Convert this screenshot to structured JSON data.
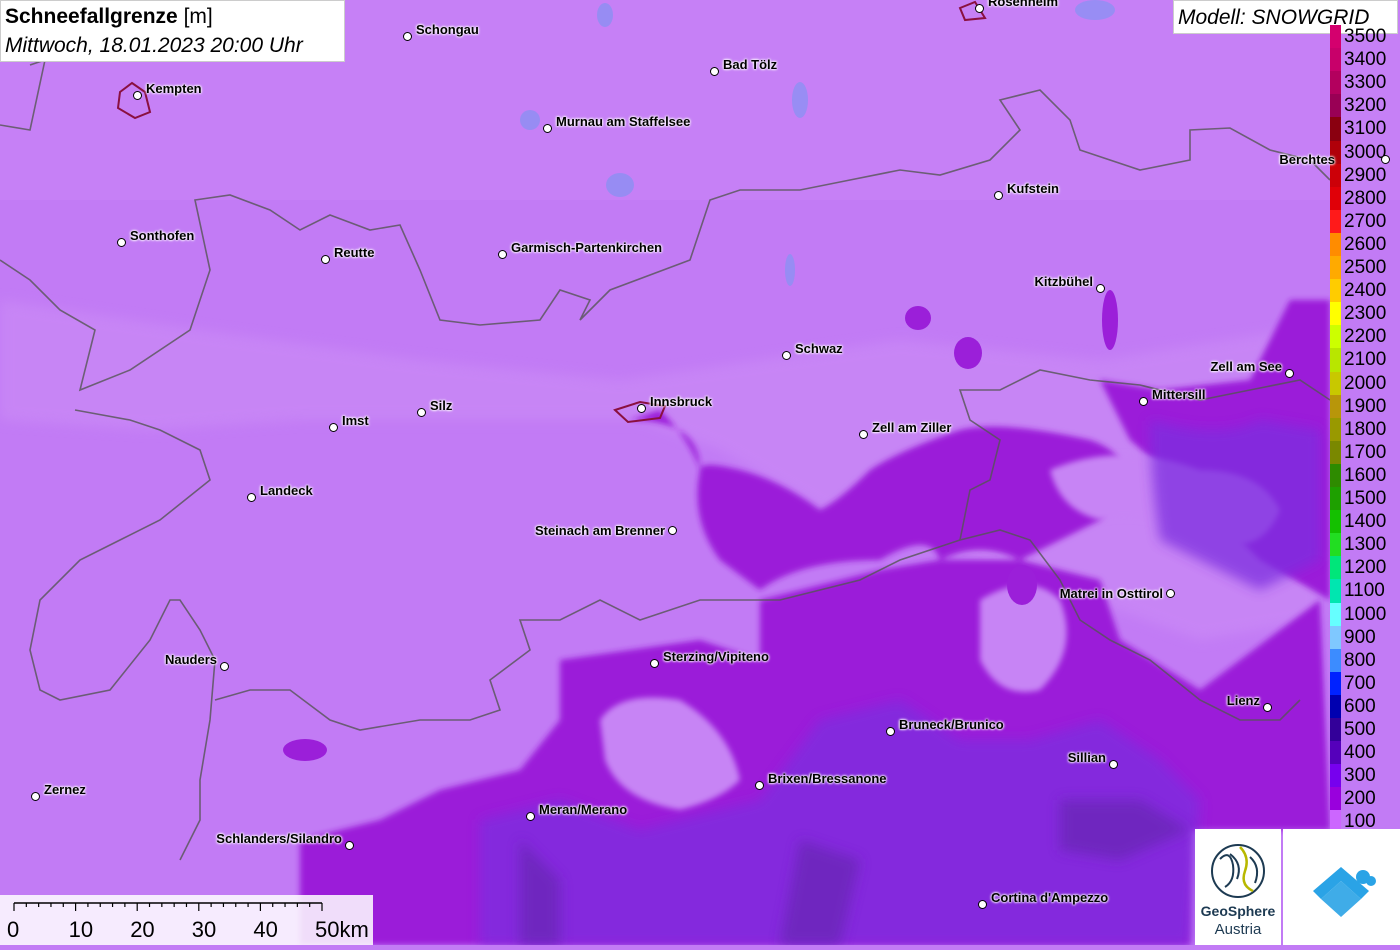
{
  "title": {
    "bold": "Schneefallgrenze",
    "unit": "[m]",
    "datetime": "Mittwoch, 18.01.2023 20:00 Uhr"
  },
  "model": "Modell: SNOWGRID",
  "legend": {
    "levels": [
      {
        "label": "3500",
        "color": "#d4006e"
      },
      {
        "label": "3400",
        "color": "#c8006a"
      },
      {
        "label": "3300",
        "color": "#b3005e"
      },
      {
        "label": "3200",
        "color": "#990055"
      },
      {
        "label": "3100",
        "color": "#8a0010"
      },
      {
        "label": "3000",
        "color": "#b0000a"
      },
      {
        "label": "2900",
        "color": "#cc0008"
      },
      {
        "label": "2800",
        "color": "#e00008"
      },
      {
        "label": "2700",
        "color": "#ff1a1a"
      },
      {
        "label": "2600",
        "color": "#ff8c00"
      },
      {
        "label": "2500",
        "color": "#ffaa00"
      },
      {
        "label": "2400",
        "color": "#ffcc00"
      },
      {
        "label": "2300",
        "color": "#ffff00"
      },
      {
        "label": "2200",
        "color": "#ccff00"
      },
      {
        "label": "2100",
        "color": "#b8e600"
      },
      {
        "label": "2000",
        "color": "#c8c800"
      },
      {
        "label": "1900",
        "color": "#b8960a"
      },
      {
        "label": "1800",
        "color": "#999900"
      },
      {
        "label": "1700",
        "color": "#7a8800"
      },
      {
        "label": "1600",
        "color": "#2e8b00"
      },
      {
        "label": "1500",
        "color": "#1ea000"
      },
      {
        "label": "1400",
        "color": "#14c000"
      },
      {
        "label": "1300",
        "color": "#22dd22"
      },
      {
        "label": "1200",
        "color": "#00e67a"
      },
      {
        "label": "1100",
        "color": "#00e6b0"
      },
      {
        "label": "1000",
        "color": "#66ffff"
      },
      {
        "label": "900",
        "color": "#7fc8ff"
      },
      {
        "label": "800",
        "color": "#3c8cff"
      },
      {
        "label": "700",
        "color": "#0022ff"
      },
      {
        "label": "600",
        "color": "#0000b0"
      },
      {
        "label": "500",
        "color": "#330099"
      },
      {
        "label": "400",
        "color": "#5500bb"
      },
      {
        "label": "300",
        "color": "#7700ee"
      },
      {
        "label": "200",
        "color": "#9900dd"
      },
      {
        "label": "100",
        "color": "#cc66ff"
      }
    ]
  },
  "cities": [
    {
      "name": "Rosenheim",
      "label_side": "right"
    },
    {
      "name": "Schongau",
      "label_side": "right"
    },
    {
      "name": "Bad Tölz",
      "label_side": "right"
    },
    {
      "name": "Kempten",
      "label_side": "right"
    },
    {
      "name": "Murnau am Staffelsee",
      "label_side": "right"
    },
    {
      "name": "Berchtes",
      "label_side": "left"
    },
    {
      "name": "Kufstein",
      "label_side": "right"
    },
    {
      "name": "Sonthofen",
      "label_side": "right"
    },
    {
      "name": "Reutte",
      "label_side": "right"
    },
    {
      "name": "Garmisch-Partenkirchen",
      "label_side": "right"
    },
    {
      "name": "Kitzbühel",
      "label_side": "left"
    },
    {
      "name": "Schwaz",
      "label_side": "right"
    },
    {
      "name": "Zell am See",
      "label_side": "left"
    },
    {
      "name": "Mittersill",
      "label_side": "right"
    },
    {
      "name": "Innsbruck",
      "label_side": "right"
    },
    {
      "name": "Silz",
      "label_side": "right"
    },
    {
      "name": "Imst",
      "label_side": "right"
    },
    {
      "name": "Zell am Ziller",
      "label_side": "right"
    },
    {
      "name": "Landeck",
      "label_side": "right"
    },
    {
      "name": "Steinach am Brenner",
      "label_side": "left"
    },
    {
      "name": "Matrei in Osttirol",
      "label_side": "left"
    },
    {
      "name": "Nauders",
      "label_side": "left"
    },
    {
      "name": "Sterzing/Vipiteno",
      "label_side": "right"
    },
    {
      "name": "Lienz",
      "label_side": "left"
    },
    {
      "name": "Bruneck/Brunico",
      "label_side": "right"
    },
    {
      "name": "Sillian",
      "label_side": "left"
    },
    {
      "name": "Brixen/Bressanone",
      "label_side": "right"
    },
    {
      "name": "Zernez",
      "label_side": "right"
    },
    {
      "name": "Meran/Merano",
      "label_side": "right"
    },
    {
      "name": "Schlanders/Silandro",
      "label_side": "left"
    },
    {
      "name": "Cortina d'Ampezzo",
      "label_side": "right"
    }
  ],
  "scale": {
    "ticks": [
      "0",
      "10",
      "20",
      "30",
      "40",
      "50km"
    ]
  },
  "logos": {
    "geosphere_line1": "GeoSphere",
    "geosphere_line2": "Austria"
  }
}
